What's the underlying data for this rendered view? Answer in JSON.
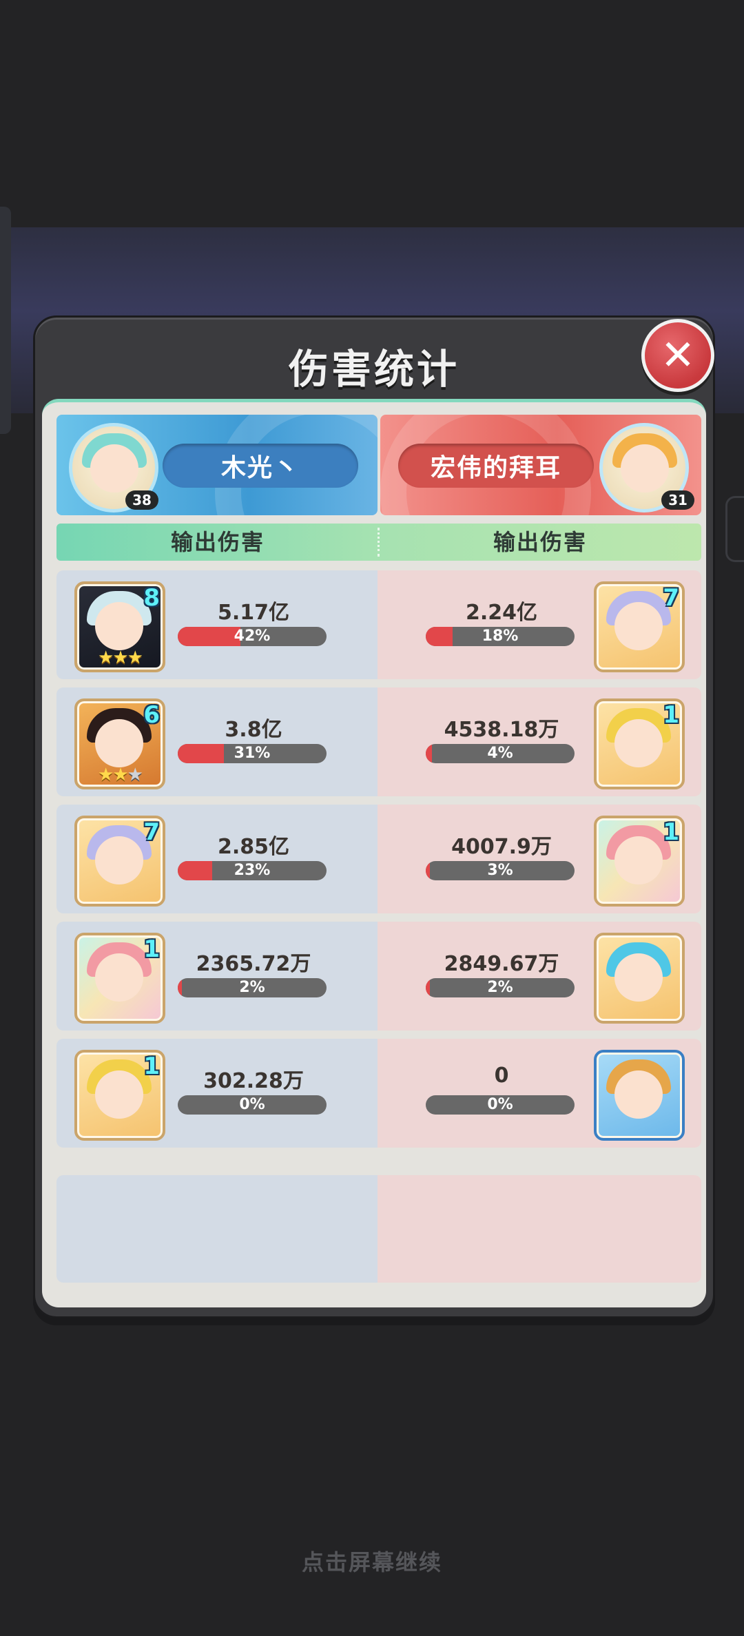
{
  "title": "伤害统计",
  "close_symbol": "✕",
  "left_player": {
    "name": "木光丶",
    "level": "38"
  },
  "right_player": {
    "name": "宏伟的拜耳",
    "level": "31"
  },
  "column_headers": {
    "left": "输出伤害",
    "right": "输出伤害"
  },
  "rows": [
    {
      "left": {
        "stars_num": "8",
        "stars": "★★★",
        "value": "5.17亿",
        "pct": "42%",
        "fraction": 0.42
      },
      "right": {
        "stars_num": "7",
        "value": "2.24亿",
        "pct": "18%",
        "fraction": 0.18
      }
    },
    {
      "left": {
        "stars_num": "6",
        "stars": "★★",
        "stars_dim": "★",
        "value": "3.8亿",
        "pct": "31%",
        "fraction": 0.31
      },
      "right": {
        "stars_num": "1",
        "value": "4538.18万",
        "pct": "4%",
        "fraction": 0.04
      }
    },
    {
      "left": {
        "stars_num": "7",
        "value": "2.85亿",
        "pct": "23%",
        "fraction": 0.23
      },
      "right": {
        "stars_num": "1",
        "value": "4007.9万",
        "pct": "3%",
        "fraction": 0.03
      }
    },
    {
      "left": {
        "stars_num": "1",
        "value": "2365.72万",
        "pct": "2%",
        "fraction": 0.02
      },
      "right": {
        "stars_num": "",
        "value": "2849.67万",
        "pct": "2%",
        "fraction": 0.02
      }
    },
    {
      "left": {
        "stars_num": "1",
        "value": "302.28万",
        "pct": "0%",
        "fraction": 0.0
      },
      "right": {
        "stars_num": "",
        "value": "0",
        "pct": "0%",
        "fraction": 0.0
      }
    }
  ],
  "footer_hint": "点击屏幕继续",
  "colors": {
    "bar_fill": "#e2474a",
    "bar_track": "#686868",
    "left_bg": "#d3dbe5",
    "right_bg": "#eed6d5",
    "accent_green": "#76d6b3"
  }
}
